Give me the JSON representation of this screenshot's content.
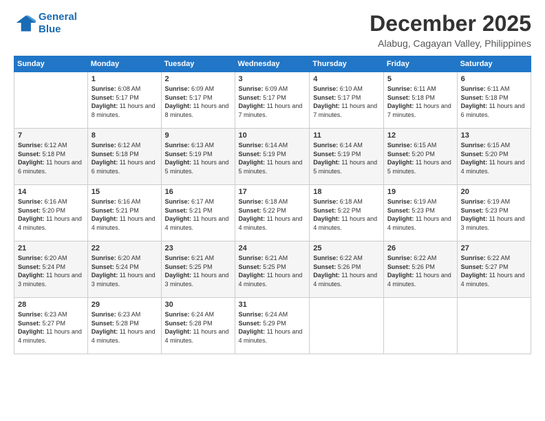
{
  "header": {
    "logo": {
      "line1": "General",
      "line2": "Blue"
    },
    "title": "December 2025",
    "location": "Alabug, Cagayan Valley, Philippines"
  },
  "weekdays": [
    "Sunday",
    "Monday",
    "Tuesday",
    "Wednesday",
    "Thursday",
    "Friday",
    "Saturday"
  ],
  "weeks": [
    [
      {
        "day": "",
        "sunrise": "",
        "sunset": "",
        "daylight": ""
      },
      {
        "day": "1",
        "sunrise": "6:08 AM",
        "sunset": "5:17 PM",
        "daylight": "11 hours and 8 minutes."
      },
      {
        "day": "2",
        "sunrise": "6:09 AM",
        "sunset": "5:17 PM",
        "daylight": "11 hours and 8 minutes."
      },
      {
        "day": "3",
        "sunrise": "6:09 AM",
        "sunset": "5:17 PM",
        "daylight": "11 hours and 7 minutes."
      },
      {
        "day": "4",
        "sunrise": "6:10 AM",
        "sunset": "5:17 PM",
        "daylight": "11 hours and 7 minutes."
      },
      {
        "day": "5",
        "sunrise": "6:11 AM",
        "sunset": "5:18 PM",
        "daylight": "11 hours and 7 minutes."
      },
      {
        "day": "6",
        "sunrise": "6:11 AM",
        "sunset": "5:18 PM",
        "daylight": "11 hours and 6 minutes."
      }
    ],
    [
      {
        "day": "7",
        "sunrise": "6:12 AM",
        "sunset": "5:18 PM",
        "daylight": "11 hours and 6 minutes."
      },
      {
        "day": "8",
        "sunrise": "6:12 AM",
        "sunset": "5:18 PM",
        "daylight": "11 hours and 6 minutes."
      },
      {
        "day": "9",
        "sunrise": "6:13 AM",
        "sunset": "5:19 PM",
        "daylight": "11 hours and 5 minutes."
      },
      {
        "day": "10",
        "sunrise": "6:14 AM",
        "sunset": "5:19 PM",
        "daylight": "11 hours and 5 minutes."
      },
      {
        "day": "11",
        "sunrise": "6:14 AM",
        "sunset": "5:19 PM",
        "daylight": "11 hours and 5 minutes."
      },
      {
        "day": "12",
        "sunrise": "6:15 AM",
        "sunset": "5:20 PM",
        "daylight": "11 hours and 5 minutes."
      },
      {
        "day": "13",
        "sunrise": "6:15 AM",
        "sunset": "5:20 PM",
        "daylight": "11 hours and 4 minutes."
      }
    ],
    [
      {
        "day": "14",
        "sunrise": "6:16 AM",
        "sunset": "5:20 PM",
        "daylight": "11 hours and 4 minutes."
      },
      {
        "day": "15",
        "sunrise": "6:16 AM",
        "sunset": "5:21 PM",
        "daylight": "11 hours and 4 minutes."
      },
      {
        "day": "16",
        "sunrise": "6:17 AM",
        "sunset": "5:21 PM",
        "daylight": "11 hours and 4 minutes."
      },
      {
        "day": "17",
        "sunrise": "6:18 AM",
        "sunset": "5:22 PM",
        "daylight": "11 hours and 4 minutes."
      },
      {
        "day": "18",
        "sunrise": "6:18 AM",
        "sunset": "5:22 PM",
        "daylight": "11 hours and 4 minutes."
      },
      {
        "day": "19",
        "sunrise": "6:19 AM",
        "sunset": "5:23 PM",
        "daylight": "11 hours and 4 minutes."
      },
      {
        "day": "20",
        "sunrise": "6:19 AM",
        "sunset": "5:23 PM",
        "daylight": "11 hours and 3 minutes."
      }
    ],
    [
      {
        "day": "21",
        "sunrise": "6:20 AM",
        "sunset": "5:24 PM",
        "daylight": "11 hours and 3 minutes."
      },
      {
        "day": "22",
        "sunrise": "6:20 AM",
        "sunset": "5:24 PM",
        "daylight": "11 hours and 3 minutes."
      },
      {
        "day": "23",
        "sunrise": "6:21 AM",
        "sunset": "5:25 PM",
        "daylight": "11 hours and 3 minutes."
      },
      {
        "day": "24",
        "sunrise": "6:21 AM",
        "sunset": "5:25 PM",
        "daylight": "11 hours and 4 minutes."
      },
      {
        "day": "25",
        "sunrise": "6:22 AM",
        "sunset": "5:26 PM",
        "daylight": "11 hours and 4 minutes."
      },
      {
        "day": "26",
        "sunrise": "6:22 AM",
        "sunset": "5:26 PM",
        "daylight": "11 hours and 4 minutes."
      },
      {
        "day": "27",
        "sunrise": "6:22 AM",
        "sunset": "5:27 PM",
        "daylight": "11 hours and 4 minutes."
      }
    ],
    [
      {
        "day": "28",
        "sunrise": "6:23 AM",
        "sunset": "5:27 PM",
        "daylight": "11 hours and 4 minutes."
      },
      {
        "day": "29",
        "sunrise": "6:23 AM",
        "sunset": "5:28 PM",
        "daylight": "11 hours and 4 minutes."
      },
      {
        "day": "30",
        "sunrise": "6:24 AM",
        "sunset": "5:28 PM",
        "daylight": "11 hours and 4 minutes."
      },
      {
        "day": "31",
        "sunrise": "6:24 AM",
        "sunset": "5:29 PM",
        "daylight": "11 hours and 4 minutes."
      },
      {
        "day": "",
        "sunrise": "",
        "sunset": "",
        "daylight": ""
      },
      {
        "day": "",
        "sunrise": "",
        "sunset": "",
        "daylight": ""
      },
      {
        "day": "",
        "sunrise": "",
        "sunset": "",
        "daylight": ""
      }
    ]
  ],
  "labels": {
    "sunrise": "Sunrise:",
    "sunset": "Sunset:",
    "daylight": "Daylight:"
  }
}
